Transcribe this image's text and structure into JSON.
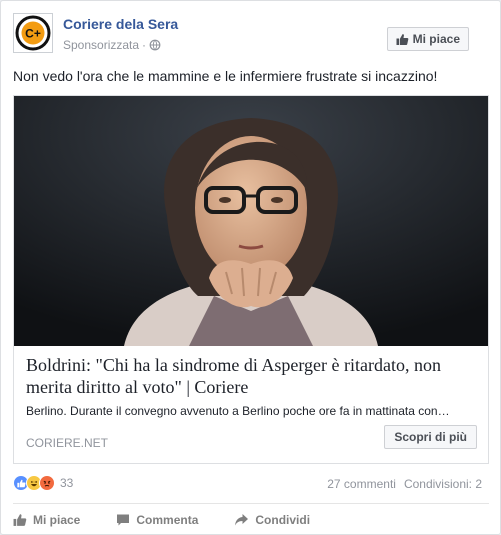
{
  "post": {
    "page_name": "Coriere dela Sera",
    "avatar_text": "C+",
    "sponsored": "Sponsorizzata",
    "separator": "·",
    "like_page_button": "Mi piace",
    "text": "Non vedo l'ora che le mammine e le infermiere frustrate si incazzino!"
  },
  "link": {
    "image_icon": "portrait-photo",
    "title": "Boldrini: \"Chi ha la sindrome di Asperger è ritardato, non merita diritto al voto\" | Coriere",
    "description": "Berlino. Durante il convegno avvenuto a Berlino poche ore fa in mattinata con…",
    "domain": "CORIERE.NET",
    "cta": "Scopri di più"
  },
  "stats": {
    "reaction_icons": [
      "like-reaction-icon",
      "haha-reaction-icon",
      "angry-reaction-icon"
    ],
    "reaction_count": "33",
    "comments": "27 commenti",
    "shares": "Condivisioni: 2"
  },
  "actions": {
    "like": "Mi piace",
    "comment": "Commenta",
    "share": "Condividi"
  },
  "colors": {
    "link_blue": "#365899",
    "meta_gray": "#90949c",
    "like_blue": "#5890ff"
  }
}
